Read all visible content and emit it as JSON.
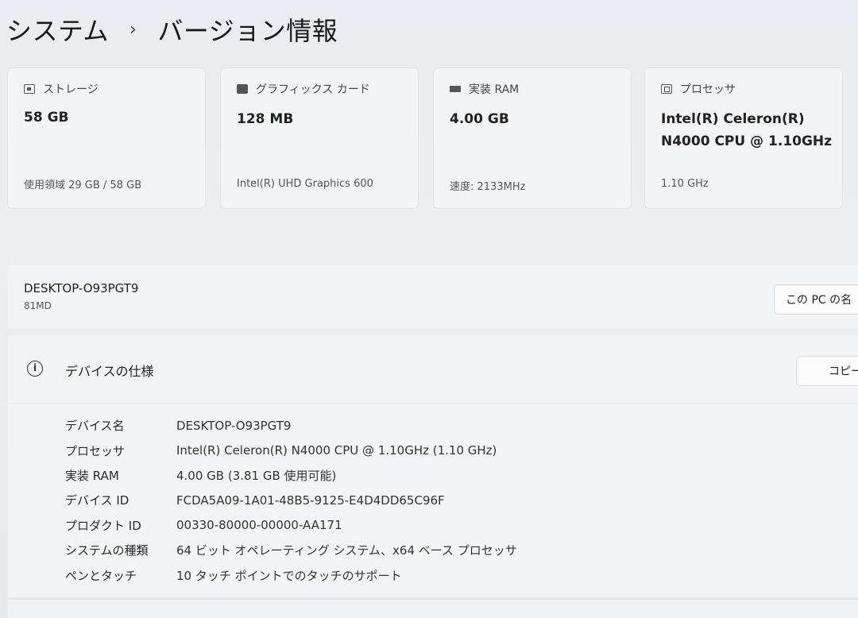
{
  "breadcrumb": {
    "parent": "システム",
    "separator": "›",
    "current": "バージョン情報"
  },
  "cards": [
    {
      "icon": "storage-icon",
      "label": "ストレージ",
      "value": "58 GB",
      "sub": "使用領域 29 GB / 58 GB"
    },
    {
      "icon": "graphics-card-icon",
      "label": "グラフィックス カード",
      "value": "128 MB",
      "sub": "Intel(R) UHD Graphics 600"
    },
    {
      "icon": "ram-icon",
      "label": "実装 RAM",
      "value": "4.00 GB",
      "sub": "速度: 2133MHz"
    },
    {
      "icon": "processor-icon",
      "label": "プロセッサ",
      "value": "Intel(R) Celeron(R) N4000 CPU @ 1.10GHz",
      "sub": "1.10 GHz"
    }
  ],
  "device": {
    "name": "DESKTOP-O93PGT9",
    "model": "81MD",
    "rename_label": "この PC の名"
  },
  "spec": {
    "title": "デバイスの仕様",
    "info_glyph": "i",
    "copy_label": "コピー",
    "rows": [
      {
        "key": "デバイス名",
        "value": "DESKTOP-O93PGT9"
      },
      {
        "key": "プロセッサ",
        "value": "Intel(R) Celeron(R) N4000 CPU @ 1.10GHz (1.10 GHz)"
      },
      {
        "key": "実装 RAM",
        "value": "4.00 GB (3.81 GB 使用可能)"
      },
      {
        "key": "デバイス ID",
        "value": "FCDA5A09-1A01-48B5-9125-E4D4DD65C96F"
      },
      {
        "key": "プロダクト ID",
        "value": "00330-80000-00000-AA171"
      },
      {
        "key": "システムの種類",
        "value": "64 ビット オペレーティング システム、x64 ベース プロセッサ"
      },
      {
        "key": "ペンとタッチ",
        "value": "10 タッチ ポイントでのタッチのサポート"
      }
    ]
  }
}
